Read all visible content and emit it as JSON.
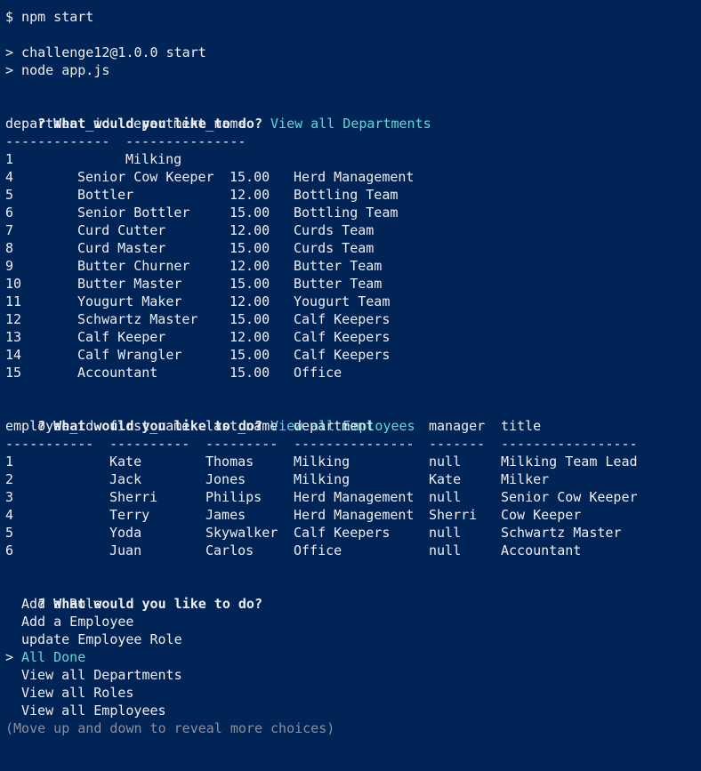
{
  "terminal": {
    "cmd_prompt": "$ npm start",
    "npm_line1": "> challenge12@1.0.0 start",
    "npm_line2": "> node app.js",
    "question": "? What would you like to do?",
    "answer_departments": "View all Departments",
    "answer_employees": "View all Employees"
  },
  "departments": {
    "headers": [
      "department_id",
      "department_name"
    ],
    "dividers": [
      "-------------",
      "---------------"
    ],
    "first_row": [
      "1",
      "Milking"
    ],
    "rows": [
      [
        "4",
        "Senior Cow Keeper",
        "15.00",
        "Herd Management"
      ],
      [
        "5",
        "Bottler",
        "12.00",
        "Bottling Team"
      ],
      [
        "6",
        "Senior Bottler",
        "15.00",
        "Bottling Team"
      ],
      [
        "7",
        "Curd Cutter",
        "12.00",
        "Curds Team"
      ],
      [
        "8",
        "Curd Master",
        "15.00",
        "Curds Team"
      ],
      [
        "9",
        "Butter Churner",
        "12.00",
        "Butter Team"
      ],
      [
        "10",
        "Butter Master",
        "15.00",
        "Butter Team"
      ],
      [
        "11",
        "Yougurt Maker",
        "12.00",
        "Yougurt Team"
      ],
      [
        "12",
        "Schwartz Master",
        "15.00",
        "Calf Keepers"
      ],
      [
        "13",
        "Calf Keeper",
        "12.00",
        "Calf Keepers"
      ],
      [
        "14",
        "Calf Wrangler",
        "15.00",
        "Calf Keepers"
      ],
      [
        "15",
        "Accountant",
        "15.00",
        "Office"
      ]
    ]
  },
  "employees": {
    "headers": [
      "employee_id",
      "first_name",
      "last_name",
      "department",
      "manager",
      "title"
    ],
    "dividers": [
      "-----------",
      "----------",
      "---------",
      "---------------",
      "-------",
      "-----------------"
    ],
    "rows": [
      [
        "1",
        "Kate",
        "Thomas",
        "Milking",
        "null",
        "Milking Team Lead"
      ],
      [
        "2",
        "Jack",
        "Jones",
        "Milking",
        "Kate",
        "Milker"
      ],
      [
        "3",
        "Sherri",
        "Philips",
        "Herd Management",
        "null",
        "Senior Cow Keeper"
      ],
      [
        "4",
        "Terry",
        "James",
        "Herd Management",
        "Sherri",
        "Cow Keeper"
      ],
      [
        "5",
        "Yoda",
        "Skywalker",
        "Calf Keepers",
        "null",
        "Schwartz Master"
      ],
      [
        "6",
        "Juan",
        "Carlos",
        "Office",
        "null",
        "Accountant"
      ]
    ]
  },
  "menu": {
    "pointer": ">",
    "options": [
      {
        "label": "Add a Role",
        "selected": false
      },
      {
        "label": "Add a Employee",
        "selected": false
      },
      {
        "label": "update Employee Role",
        "selected": false
      },
      {
        "label": "All Done",
        "selected": true
      },
      {
        "label": "View all Departments",
        "selected": false
      },
      {
        "label": "View all Roles",
        "selected": false
      },
      {
        "label": "View all Employees",
        "selected": false
      }
    ],
    "hint": "(Move up and down to reveal more choices)"
  },
  "colors": {
    "background": "#012456",
    "text": "#eeedf0",
    "accent": "#61d6d6",
    "hint": "#8a8f9e"
  }
}
